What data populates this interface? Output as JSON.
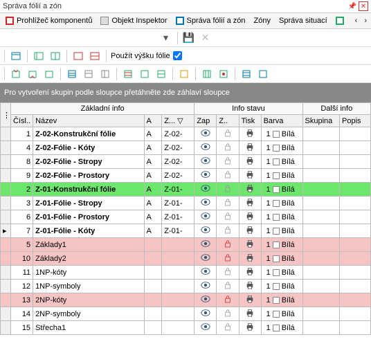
{
  "titlebar": {
    "title": "Správa fólií a zón"
  },
  "tabs": {
    "components": "Prohlížeč komponentů",
    "inspector": "Objekt Inspektor",
    "folie": "Správa fólií a zón",
    "zones": "Zóny",
    "situation": "Správa situací"
  },
  "checkbox_label": "Použít výšku fólie",
  "group_hint": "Pro vytvoření skupin podle sloupce přetáhněte zde záhlaví sloupce",
  "headers": {
    "group1": "Základní info",
    "group2": "Info stavu",
    "group3": "Další info",
    "num": "Čísl..",
    "name": "Název",
    "a": "A",
    "z": "Z... ▽",
    "zap": "Zap",
    "zlock": "Z..",
    "tisk": "Tisk",
    "barva": "Barva",
    "skupina": "Skupina",
    "popis": "Popis"
  },
  "rows": [
    {
      "n": "1",
      "name": "Z-02-Konstrukční fólie",
      "a": "A",
      "z": "Z-02-",
      "b": "1",
      "bn": "Bílá",
      "bold": true,
      "cls": ""
    },
    {
      "n": "4",
      "name": "Z-02-Fólie - Kóty",
      "a": "A",
      "z": "Z-02-",
      "b": "1",
      "bn": "Bílá",
      "bold": true,
      "cls": ""
    },
    {
      "n": "8",
      "name": "Z-02-Fólie - Stropy",
      "a": "A",
      "z": "Z-02-",
      "b": "1",
      "bn": "Bílá",
      "bold": true,
      "cls": ""
    },
    {
      "n": "9",
      "name": "Z-02-Fólie - Prostory",
      "a": "A",
      "z": "Z-02-",
      "b": "1",
      "bn": "Bílá",
      "bold": true,
      "cls": ""
    },
    {
      "n": "2",
      "name": "Z-01-Konstrukční fólie",
      "a": "A",
      "z": "Z-01-",
      "b": "1",
      "bn": "Bílá",
      "bold": true,
      "cls": "row-green"
    },
    {
      "n": "3",
      "name": "Z-01-Fólie - Stropy",
      "a": "A",
      "z": "Z-01-",
      "b": "1",
      "bn": "Bílá",
      "bold": true,
      "cls": ""
    },
    {
      "n": "6",
      "name": "Z-01-Fólie - Prostory",
      "a": "A",
      "z": "Z-01-",
      "b": "1",
      "bn": "Bílá",
      "bold": true,
      "cls": ""
    },
    {
      "n": "7",
      "name": "Z-01-Fólie - Kóty",
      "a": "A",
      "z": "Z-01-",
      "b": "1",
      "bn": "Bílá",
      "bold": true,
      "cls": "",
      "marker": "▸"
    },
    {
      "n": "5",
      "name": "Základy1",
      "a": "",
      "z": "",
      "b": "1",
      "bn": "Bílá",
      "bold": false,
      "cls": "row-pink",
      "lock": "red"
    },
    {
      "n": "10",
      "name": "Základy2",
      "a": "",
      "z": "",
      "b": "1",
      "bn": "Bílá",
      "bold": false,
      "cls": "row-pink",
      "lock": "red"
    },
    {
      "n": "11",
      "name": "1NP-kóty",
      "a": "",
      "z": "",
      "b": "1",
      "bn": "Bílá",
      "bold": false,
      "cls": ""
    },
    {
      "n": "12",
      "name": "1NP-symboly",
      "a": "",
      "z": "",
      "b": "1",
      "bn": "Bílá",
      "bold": false,
      "cls": ""
    },
    {
      "n": "13",
      "name": "2NP-kóty",
      "a": "",
      "z": "",
      "b": "1",
      "bn": "Bílá",
      "bold": false,
      "cls": "row-pink",
      "lock": "red"
    },
    {
      "n": "14",
      "name": "2NP-symboly",
      "a": "",
      "z": "",
      "b": "1",
      "bn": "Bílá",
      "bold": false,
      "cls": ""
    },
    {
      "n": "15",
      "name": "Střecha1",
      "a": "",
      "z": "",
      "b": "1",
      "bn": "Bílá",
      "bold": false,
      "cls": ""
    }
  ]
}
